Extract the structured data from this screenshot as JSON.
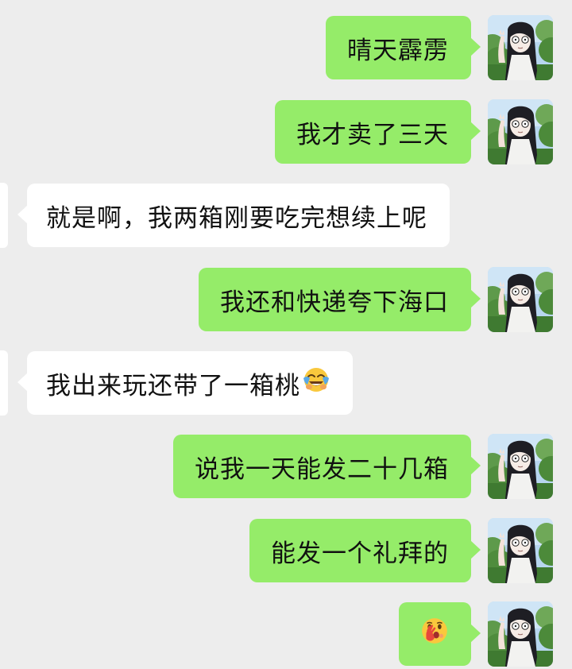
{
  "messages": [
    {
      "side": "sent",
      "text": "晴天霹雳"
    },
    {
      "side": "sent",
      "text": "我才卖了三天"
    },
    {
      "side": "recv",
      "text": "就是啊，我两箱刚要吃完想续上呢"
    },
    {
      "side": "sent",
      "text": "我还和快递夸下海口"
    },
    {
      "side": "recv",
      "text": "我出来玩还带了一箱桃",
      "emoji": "face-with-tears-of-joy-icon"
    },
    {
      "side": "sent",
      "text": "说我一天能发二十几箱"
    },
    {
      "side": "sent",
      "text": "能发一个礼拜的"
    },
    {
      "side": "sent",
      "text": "",
      "emoji": "face-with-hand-over-mouth-icon"
    }
  ],
  "colors": {
    "background": "#ededed",
    "sent_bubble": "#95ec69",
    "received_bubble": "#ffffff"
  },
  "avatar": {
    "icon": "anime-girl-avatar-icon"
  }
}
